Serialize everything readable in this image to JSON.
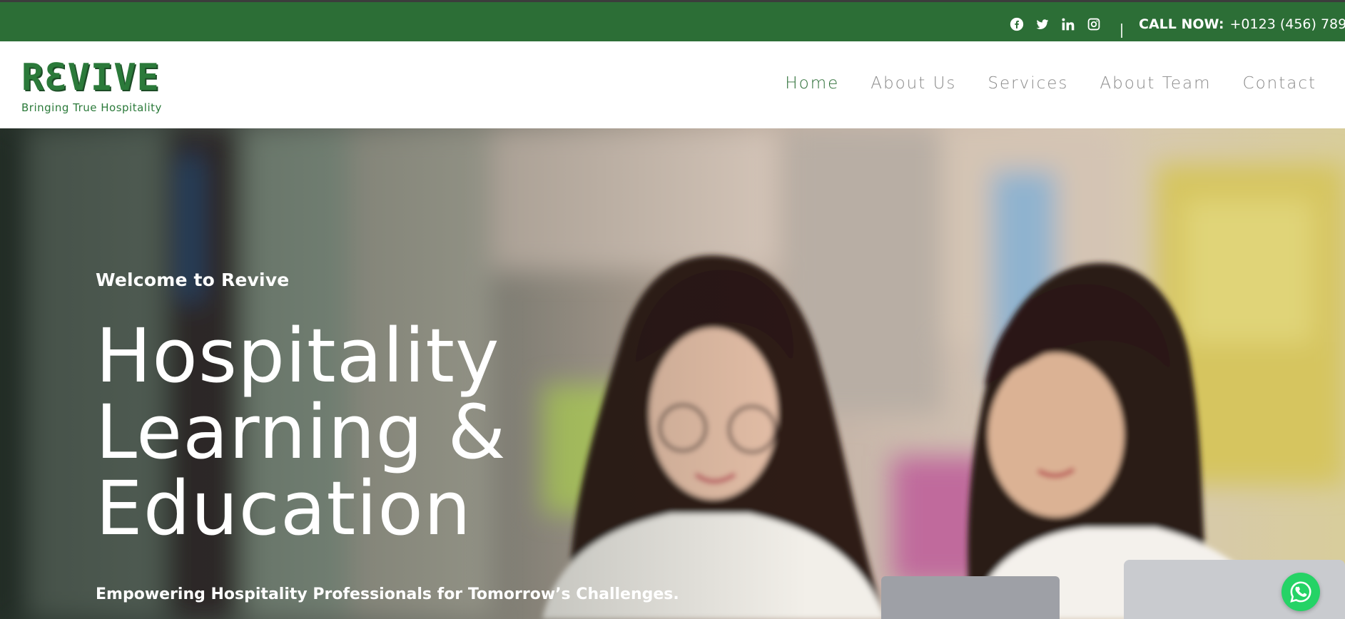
{
  "topbar": {
    "social_icons": [
      "facebook-icon",
      "twitter-icon",
      "linkedin-icon",
      "instagram-icon"
    ],
    "call_label": "CALL NOW:",
    "call_number": "+0123 (456) 789",
    "background_color": "#2c6e36"
  },
  "header": {
    "logo_text": "RƐVIVE",
    "logo_tagline": "Bringing True Hospitality",
    "nav": [
      {
        "label": "Home",
        "active": true
      },
      {
        "label": "About Us",
        "active": false
      },
      {
        "label": "Services",
        "active": false
      },
      {
        "label": "About Team",
        "active": false
      },
      {
        "label": "Contact",
        "active": false
      }
    ],
    "accent_color": "#2c6e36"
  },
  "hero": {
    "welcome": "Welcome to Revive",
    "title_line1": "Hospitality",
    "title_line2": "Learning &",
    "title_line3": "Education",
    "subtitle": "Empowering Hospitality Professionals for Tomorrow’s Challenges."
  },
  "floating": {
    "whatsapp_icon": "whatsapp-icon",
    "whatsapp_color": "#25d366"
  }
}
